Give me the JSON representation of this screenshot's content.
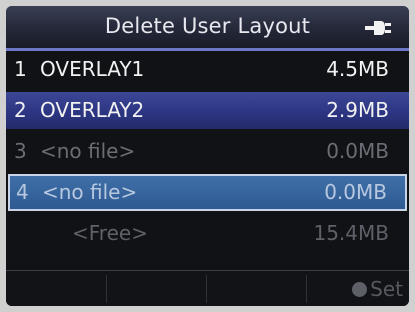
{
  "header": {
    "title": "Delete User Layout",
    "icon": "power-plug-icon"
  },
  "files": [
    {
      "number": "1",
      "name": "OVERLAY1",
      "size": "4.5MB",
      "state": "normal"
    },
    {
      "number": "2",
      "name": "OVERLAY2",
      "size": "2.9MB",
      "state": "selected"
    },
    {
      "number": "3",
      "name": "<no file>",
      "size": "0.0MB",
      "state": "disabled"
    },
    {
      "number": "4",
      "name": "<no file>",
      "size": "0.0MB",
      "state": "focused"
    }
  ],
  "free": {
    "label": "<Free>",
    "size": "15.4MB"
  },
  "footer": {
    "set_label": "Set",
    "set_icon": "circle-button-icon"
  },
  "colors": {
    "title_underline": "#6f78c8",
    "selected_row": "#2b3480",
    "focused_row": "#2f5a92"
  }
}
